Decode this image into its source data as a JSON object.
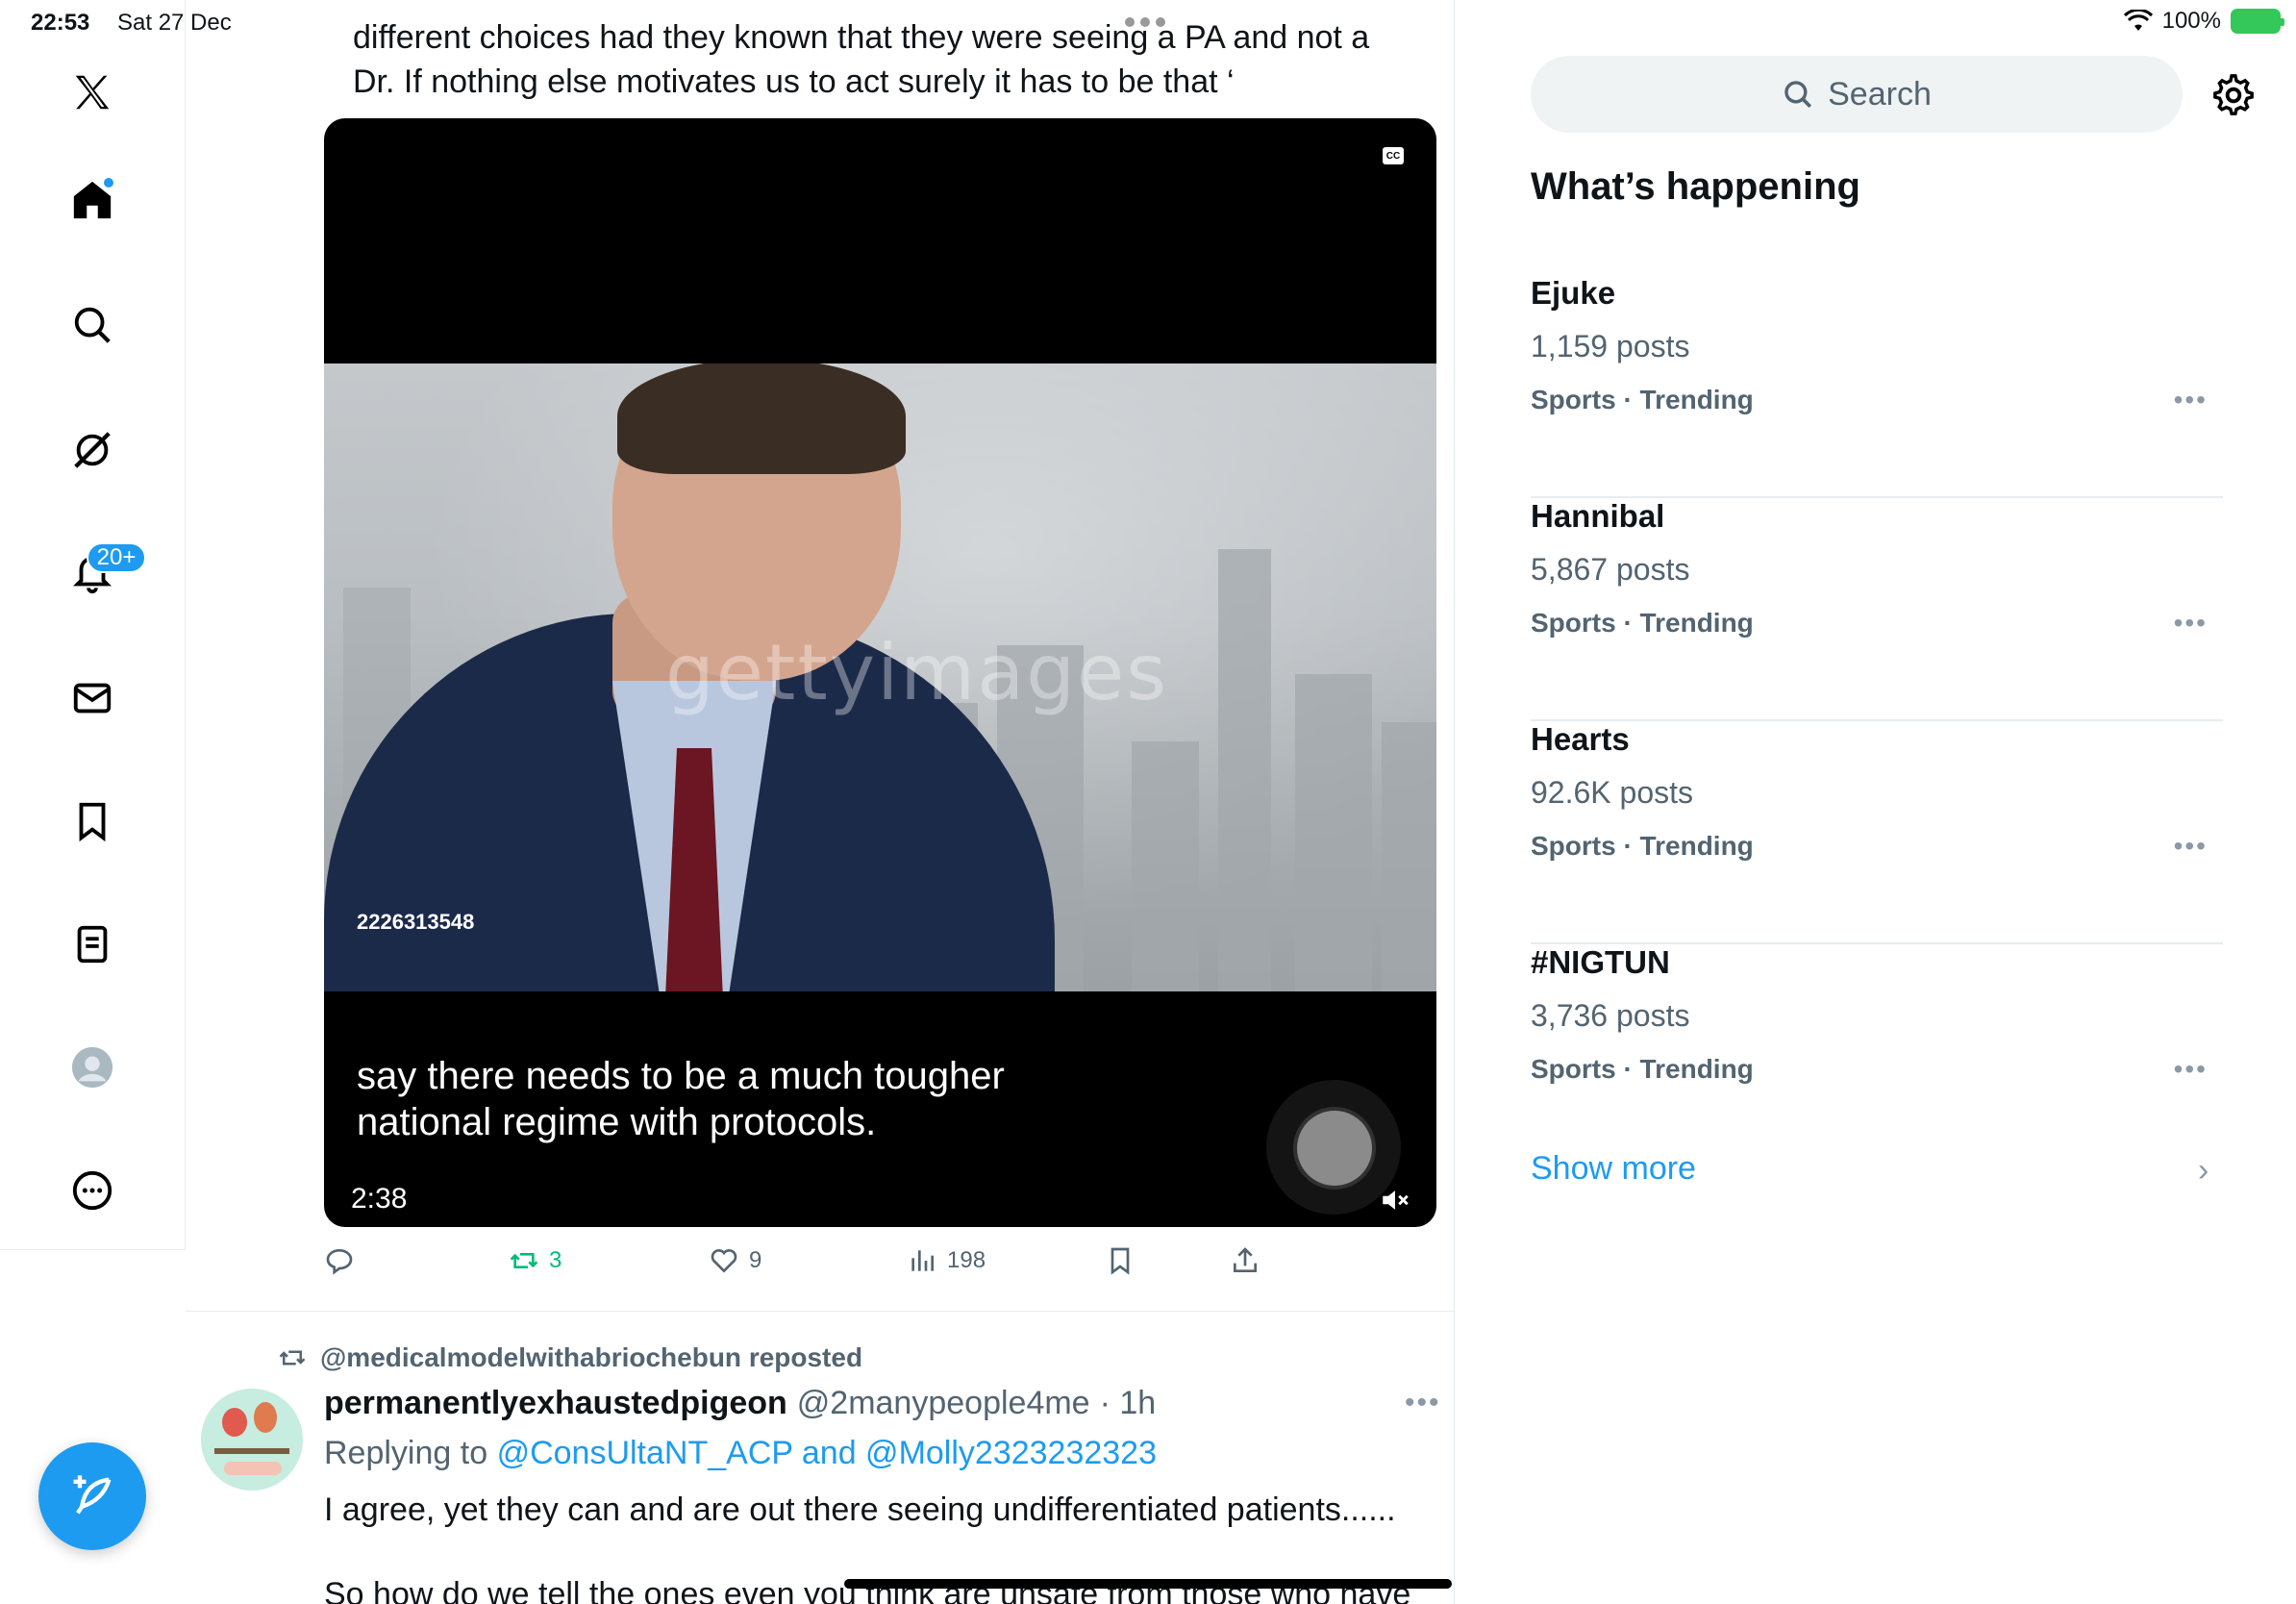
{
  "status_bar": {
    "time": "22:53",
    "date": "Sat 27 Dec",
    "battery": "100%"
  },
  "nav": {
    "notifications_badge": "20+"
  },
  "tweet": {
    "text_lines": [
      "different choices had they known that they were seeing a PA and not a",
      "Dr. If nothing else motivates us to act surely it has to be that ‘"
    ],
    "video": {
      "watermark": "gettyimages",
      "image_id": "2226313548",
      "caption_line1": "say there needs to be a much tougher",
      "caption_line2": "national regime with protocols.",
      "duration": "2:38",
      "cc": "CC"
    },
    "actions": {
      "retweets": "3",
      "likes": "9",
      "views": "198"
    }
  },
  "next_tweet": {
    "repost_label": "@medicalmodelwithabriochebun reposted",
    "author_name": "permanentlyexhaustedpigeon",
    "author_handle": "@2manypeople4me",
    "time": "· 1h",
    "reply_prefix": "Replying to",
    "reply_mentions": "@ConsUltaNT_ACP and @Molly2323232323",
    "body_line1": "I agree, yet they can and are out there seeing undifferentiated patients......",
    "body_line2": "So how do we tell the ones even you think are unsafe from those who have"
  },
  "sidebar": {
    "search_placeholder": "Search",
    "section_title": "What’s happening",
    "trends": [
      {
        "name": "Ejuke",
        "count": "1,159 posts",
        "meta": "Sports · Trending"
      },
      {
        "name": "Hannibal",
        "count": "5,867 posts",
        "meta": "Sports · Trending"
      },
      {
        "name": "Hearts",
        "count": "92.6K posts",
        "meta": "Sports · Trending"
      },
      {
        "name": "#NIGTUN",
        "count": "3,736 posts",
        "meta": "Sports · Trending"
      }
    ],
    "show_more": "Show more"
  },
  "colors": {
    "accent": "#1d9bf0",
    "retweet_green": "#00ba7c",
    "secondary_text": "#536471"
  }
}
